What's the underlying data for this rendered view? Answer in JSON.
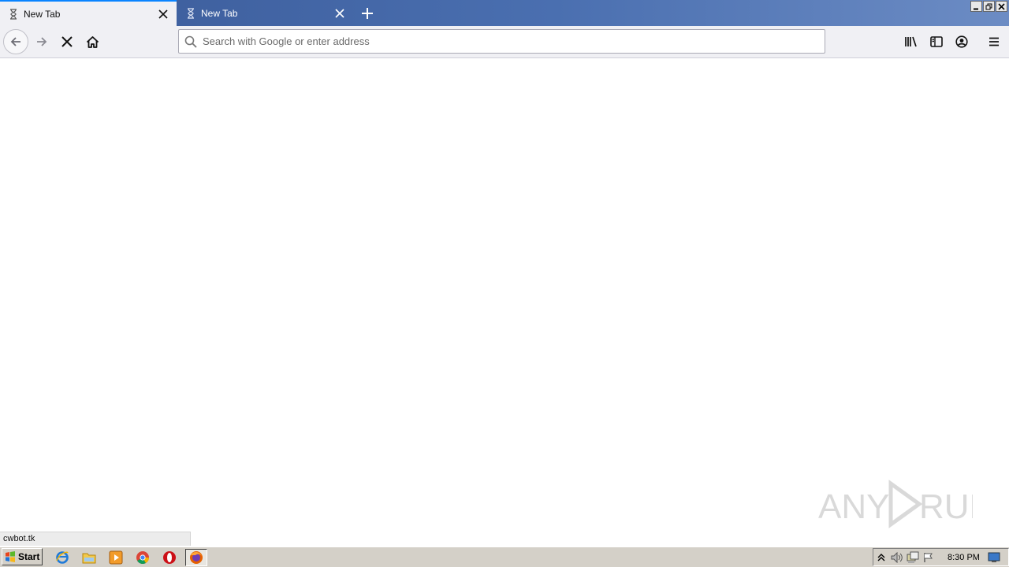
{
  "tabs": [
    {
      "title": "New Tab",
      "active": true
    },
    {
      "title": "New Tab",
      "active": false
    }
  ],
  "urlbar": {
    "placeholder": "Search with Google or enter address",
    "value": ""
  },
  "status": {
    "text": "cwbot.tk"
  },
  "watermark": {
    "text": "ANY RUN"
  },
  "taskbar": {
    "start_label": "Start",
    "clock": "8:30 PM"
  },
  "colors": {
    "titlebar": "#3a5a98",
    "accent": "#0a84ff",
    "toolbar": "#f0f0f4",
    "taskbar": "#d4d0c8"
  },
  "icons": {
    "toolbar": [
      "back-icon",
      "forward-icon",
      "stop-icon",
      "home-icon",
      "library-icon",
      "sidebar-icon",
      "account-icon",
      "menu-icon"
    ],
    "quicklaunch": [
      "internet-explorer-icon",
      "file-explorer-icon",
      "media-player-icon",
      "chrome-icon",
      "opera-icon",
      "firefox-icon"
    ],
    "tray": [
      "show-hidden-icon",
      "volume-icon",
      "network-icon",
      "action-center-flag-icon",
      "show-desktop-icon"
    ]
  }
}
